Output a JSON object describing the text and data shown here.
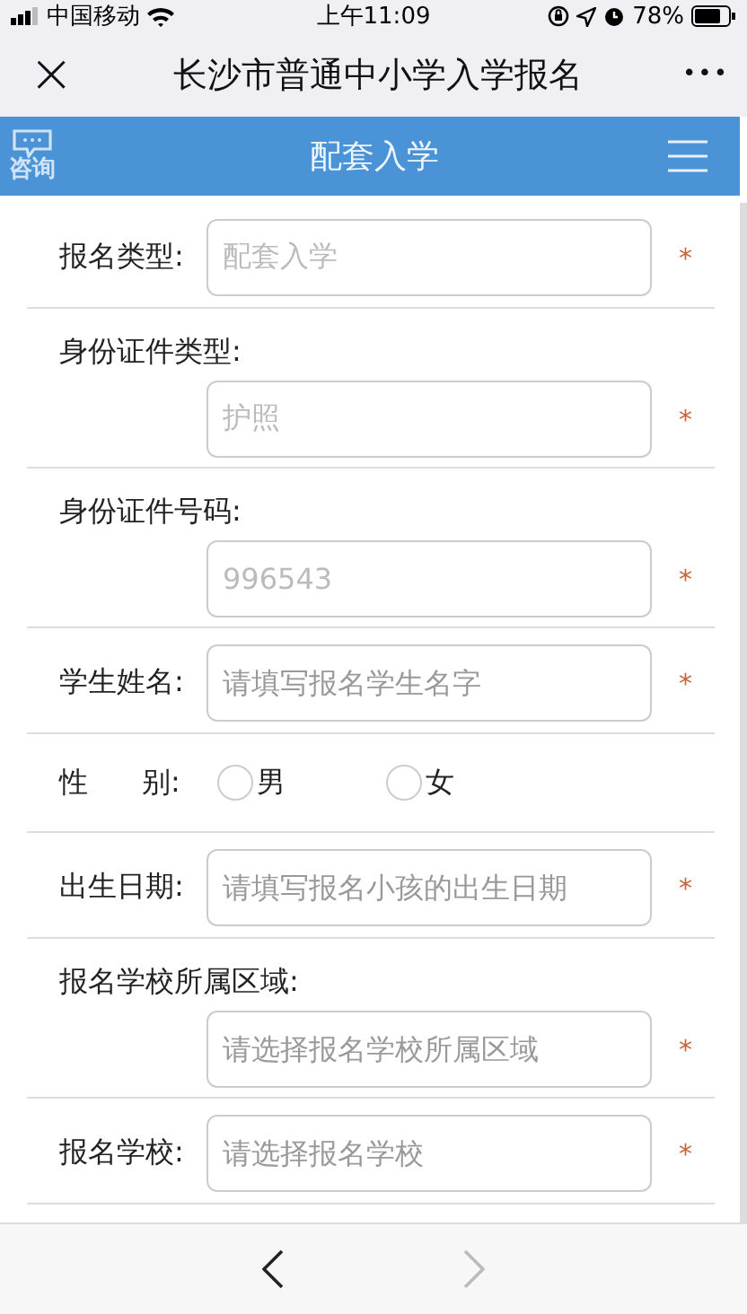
{
  "status_bar": {
    "carrier": "中国移动",
    "time": "上午11:09",
    "battery": "78%"
  },
  "nav_bar": {
    "close": "×",
    "title": "长沙市普通中小学入学报名",
    "more": "•••"
  },
  "header": {
    "consult": "咨询",
    "title": "配套入学"
  },
  "form": [
    {
      "kind": "inline",
      "label": "报名类型:",
      "value": "配套入学",
      "required_mark": "*"
    },
    {
      "kind": "stacked",
      "label": "身份证件类型:",
      "value": "护照",
      "required_mark": "*"
    },
    {
      "kind": "stacked",
      "label": "身份证件号码:",
      "value": "996543",
      "required_mark": "*"
    },
    {
      "kind": "inline",
      "label": "学生姓名:",
      "placeholder": "请填写报名学生名字",
      "required_mark": "*"
    },
    {
      "kind": "radio",
      "label_1": "性",
      "label_2": "别:",
      "options": [
        {
          "label": "男",
          "selected": false
        },
        {
          "label": "女",
          "selected": false
        }
      ]
    },
    {
      "kind": "inline",
      "label": "出生日期:",
      "placeholder": "请填写报名小孩的出生日期",
      "required_mark": "*"
    },
    {
      "kind": "stacked",
      "label": "报名学校所属区域:",
      "placeholder": "请选择报名学校所属区域",
      "required_mark": "*"
    },
    {
      "kind": "inline",
      "label": "报名学校:",
      "placeholder": "请选择报名学校",
      "required_mark": "*"
    }
  ],
  "toolbar": {
    "back_enabled": true,
    "forward_enabled": false
  }
}
